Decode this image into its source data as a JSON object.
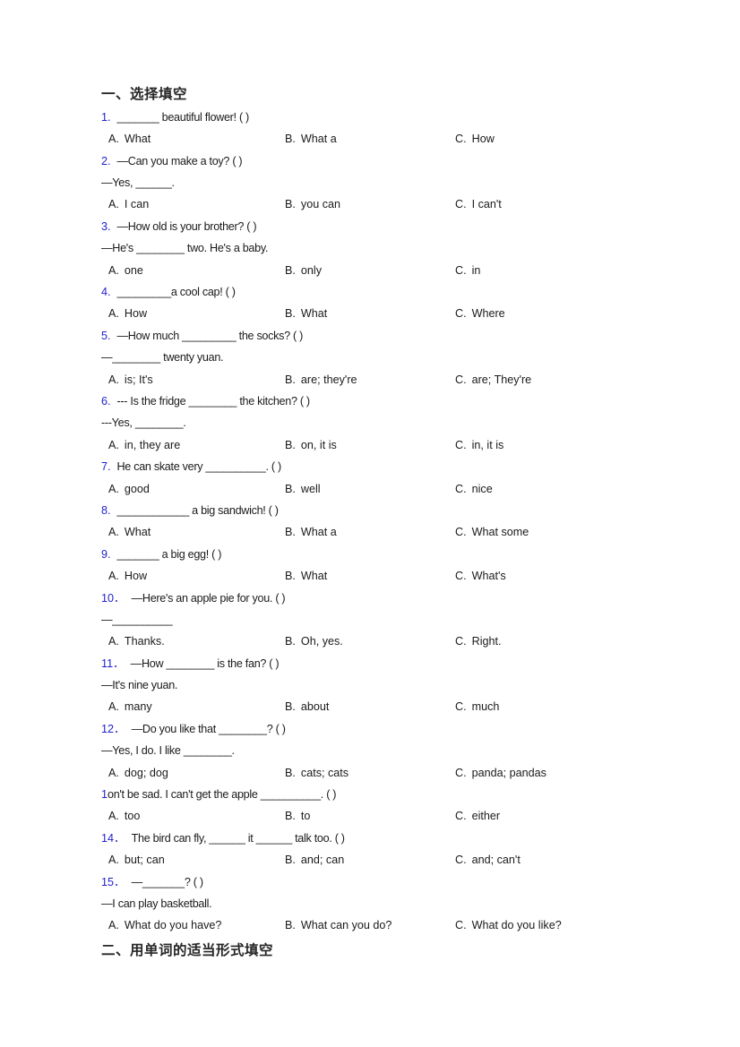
{
  "document": {
    "headings": {
      "section_one": "一、选择填空",
      "section_two": "二、用单词的适当形式填空"
    },
    "accent_color": "#2222cc",
    "text_color": "#1a1a1a",
    "background": "#ffffff"
  },
  "questions": [
    {
      "number": "1.",
      "stem": "_______ beautiful flower! (    )",
      "continuation": null,
      "options": [
        {
          "letter": "A.",
          "text": "What"
        },
        {
          "letter": "B.",
          "text": "What a"
        },
        {
          "letter": "C.",
          "text": "How"
        }
      ]
    },
    {
      "number": "2.",
      "stem": "—Can you make a toy? (  )",
      "continuation": "—Yes, ______.",
      "options": [
        {
          "letter": "A.",
          "text": "I can"
        },
        {
          "letter": "B.",
          "text": "you can"
        },
        {
          "letter": "C.",
          "text": "I can't"
        }
      ]
    },
    {
      "number": "3.",
      "stem": "—How old is your brother? (  )",
      "continuation": "—He's ________ two. He's a baby.",
      "options": [
        {
          "letter": "A.",
          "text": "one"
        },
        {
          "letter": "B.",
          "text": "only"
        },
        {
          "letter": "C.",
          "text": "in"
        }
      ]
    },
    {
      "number": "4.",
      "stem": "_________a cool cap! (  )",
      "continuation": null,
      "options": [
        {
          "letter": "A.",
          "text": "How"
        },
        {
          "letter": "B.",
          "text": "What"
        },
        {
          "letter": "C.",
          "text": "Where"
        }
      ]
    },
    {
      "number": "5.",
      "stem": "—How much _________ the socks? (  )",
      "continuation": "—________ twenty yuan.",
      "options": [
        {
          "letter": "A.",
          "text": "is; It's"
        },
        {
          "letter": "B.",
          "text": "are; they're"
        },
        {
          "letter": "C.",
          "text": "are; They're"
        }
      ]
    },
    {
      "number": "6.",
      "stem": "--- Is the fridge ________ the kitchen? (   )",
      "continuation": "---Yes, ________.",
      "options": [
        {
          "letter": "A.",
          "text": "in, they are"
        },
        {
          "letter": "B.",
          "text": "on, it is"
        },
        {
          "letter": "C.",
          "text": "in, it is"
        }
      ]
    },
    {
      "number": "7.",
      "stem": "He can skate very __________.  (      )",
      "continuation": null,
      "options": [
        {
          "letter": "A.",
          "text": "good"
        },
        {
          "letter": "B.",
          "text": "well"
        },
        {
          "letter": "C.",
          "text": "nice"
        }
      ]
    },
    {
      "number": "8.",
      "stem": "____________ a big sandwich! (  )",
      "continuation": null,
      "options": [
        {
          "letter": "A.",
          "text": "What"
        },
        {
          "letter": "B.",
          "text": "What a"
        },
        {
          "letter": "C.",
          "text": "What some"
        }
      ]
    },
    {
      "number": "9.",
      "stem": "_______ a big egg! (  )",
      "continuation": null,
      "options": [
        {
          "letter": "A.",
          "text": "How"
        },
        {
          "letter": "B.",
          "text": "What"
        },
        {
          "letter": "C.",
          "text": "What's"
        }
      ]
    },
    {
      "number": "10．",
      "stem": "—Here's an apple pie for you. (   )",
      "continuation": "—__________",
      "options": [
        {
          "letter": "A.",
          "text": "Thanks."
        },
        {
          "letter": "B.",
          "text": "Oh, yes."
        },
        {
          "letter": "C.",
          "text": "Right."
        }
      ]
    },
    {
      "number": "11．",
      "stem": "—How ________ is the fan? (     )",
      "continuation": "—It's nine yuan.",
      "options": [
        {
          "letter": "A.",
          "text": "many"
        },
        {
          "letter": "B.",
          "text": "about"
        },
        {
          "letter": "C.",
          "text": "much"
        }
      ]
    },
    {
      "number": "12．",
      "stem": "—Do you like that ________? (  )",
      "continuation": "—Yes, I do. I like ________.",
      "options": [
        {
          "letter": "A.",
          "text": "dog; dog"
        },
        {
          "letter": "B.",
          "text": "cats; cats"
        },
        {
          "letter": "C.",
          "text": "panda; pandas"
        }
      ]
    },
    {
      "number": "1",
      "number_partial": true,
      "stem": "on't be sad. I can't get the apple __________. (   )",
      "continuation": null,
      "options": [
        {
          "letter": "A.",
          "text": "too"
        },
        {
          "letter": "B.",
          "text": "to"
        },
        {
          "letter": "C.",
          "text": "either"
        }
      ]
    },
    {
      "number": "14．",
      "stem": "The bird can fly, ______ it ______ talk too. (  )",
      "continuation": null,
      "options": [
        {
          "letter": "A.",
          "text": "but; can"
        },
        {
          "letter": "B.",
          "text": "and; can"
        },
        {
          "letter": "C.",
          "text": "and; can't"
        }
      ]
    },
    {
      "number": "15．",
      "stem": "—_______? (  )",
      "continuation": "—I can play basketball.",
      "options": [
        {
          "letter": "A.",
          "text": "What do you have?"
        },
        {
          "letter": "B.",
          "text": "What can you do?"
        },
        {
          "letter": "C.",
          "text": "What do you like?"
        }
      ]
    }
  ]
}
